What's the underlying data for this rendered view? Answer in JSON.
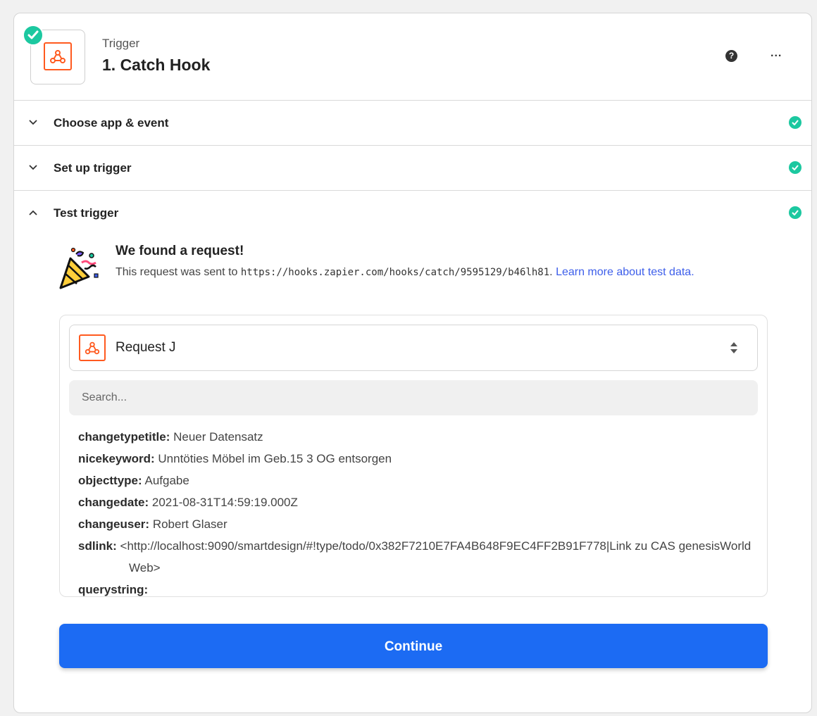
{
  "header": {
    "subtitle": "Trigger",
    "title": "1. Catch Hook",
    "help_label": "?",
    "more_label": "..."
  },
  "steps": [
    {
      "label": "Choose app & event",
      "state": "collapsed",
      "complete": true
    },
    {
      "label": "Set up trigger",
      "state": "collapsed",
      "complete": true
    },
    {
      "label": "Test trigger",
      "state": "expanded",
      "complete": true
    }
  ],
  "found": {
    "title": "We found a request!",
    "desc_prefix": "This request was sent to ",
    "url": "https://hooks.zapier.com/hooks/catch/9595129/b46lh81",
    "desc_period": ".",
    "link_text": "Learn more about test data."
  },
  "request_selector": {
    "selected": "Request J"
  },
  "search": {
    "placeholder": "Search..."
  },
  "fields": [
    {
      "key": "changetypetitle:",
      "value": "Neuer Datensatz"
    },
    {
      "key": "nicekeyword:",
      "value": "Unntöties Möbel im Geb.15 3 OG entsorgen"
    },
    {
      "key": "objecttype:",
      "value": "Aufgabe"
    },
    {
      "key": "changedate:",
      "value": "2021-08-31T14:59:19.000Z"
    },
    {
      "key": "changeuser:",
      "value": "Robert Glaser"
    },
    {
      "key": "sdlink:",
      "value": "<http://localhost:9090/smartdesign/#!type/todo/0x382F7210E7FA4B648F9EC4FF2B91F778|Link zu CAS genesisWorld Web>"
    },
    {
      "key": "querystring:",
      "value": ""
    }
  ],
  "continue_label": "Continue",
  "colors": {
    "accent": "#1c6bf3",
    "success": "#1cc8a0",
    "webhook_orange": "#ff5a1f",
    "link": "#3d5eea"
  },
  "icons": {
    "app": "webhook-icon",
    "complete": "check-circle-icon",
    "celebration": "party-popper-icon"
  }
}
